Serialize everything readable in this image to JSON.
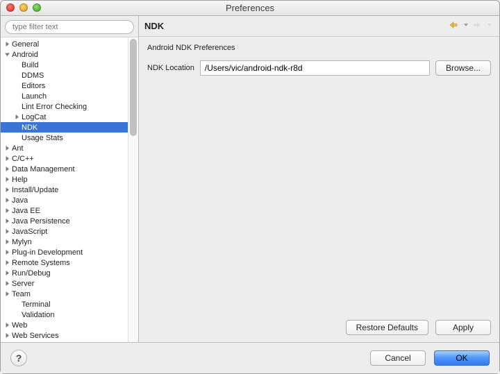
{
  "window": {
    "title": "Preferences"
  },
  "sidebar": {
    "filter_placeholder": "type filter text",
    "items": [
      {
        "label": "General",
        "depth": 0,
        "arrow": "right"
      },
      {
        "label": "Android",
        "depth": 0,
        "arrow": "down"
      },
      {
        "label": "Build",
        "depth": 1,
        "arrow": "none"
      },
      {
        "label": "DDMS",
        "depth": 1,
        "arrow": "none"
      },
      {
        "label": "Editors",
        "depth": 1,
        "arrow": "none"
      },
      {
        "label": "Launch",
        "depth": 1,
        "arrow": "none"
      },
      {
        "label": "Lint Error Checking",
        "depth": 1,
        "arrow": "none"
      },
      {
        "label": "LogCat",
        "depth": 1,
        "arrow": "right"
      },
      {
        "label": "NDK",
        "depth": 1,
        "arrow": "none",
        "selected": true
      },
      {
        "label": "Usage Stats",
        "depth": 1,
        "arrow": "none"
      },
      {
        "label": "Ant",
        "depth": 0,
        "arrow": "right"
      },
      {
        "label": "C/C++",
        "depth": 0,
        "arrow": "right"
      },
      {
        "label": "Data Management",
        "depth": 0,
        "arrow": "right"
      },
      {
        "label": "Help",
        "depth": 0,
        "arrow": "right"
      },
      {
        "label": "Install/Update",
        "depth": 0,
        "arrow": "right"
      },
      {
        "label": "Java",
        "depth": 0,
        "arrow": "right"
      },
      {
        "label": "Java EE",
        "depth": 0,
        "arrow": "right"
      },
      {
        "label": "Java Persistence",
        "depth": 0,
        "arrow": "right"
      },
      {
        "label": "JavaScript",
        "depth": 0,
        "arrow": "right"
      },
      {
        "label": "Mylyn",
        "depth": 0,
        "arrow": "right"
      },
      {
        "label": "Plug-in Development",
        "depth": 0,
        "arrow": "right"
      },
      {
        "label": "Remote Systems",
        "depth": 0,
        "arrow": "right"
      },
      {
        "label": "Run/Debug",
        "depth": 0,
        "arrow": "right"
      },
      {
        "label": "Server",
        "depth": 0,
        "arrow": "right"
      },
      {
        "label": "Team",
        "depth": 0,
        "arrow": "right"
      },
      {
        "label": "Terminal",
        "depth": 1,
        "arrow": "none"
      },
      {
        "label": "Validation",
        "depth": 1,
        "arrow": "none"
      },
      {
        "label": "Web",
        "depth": 0,
        "arrow": "right"
      },
      {
        "label": "Web Services",
        "depth": 0,
        "arrow": "right"
      }
    ]
  },
  "main": {
    "title": "NDK",
    "section_label": "Android NDK Preferences",
    "field_label": "NDK Location",
    "ndk_location": "/Users/vic/android-ndk-r8d",
    "browse_label": "Browse...",
    "restore_label": "Restore Defaults",
    "apply_label": "Apply"
  },
  "footer": {
    "help_label": "?",
    "cancel_label": "Cancel",
    "ok_label": "OK"
  }
}
